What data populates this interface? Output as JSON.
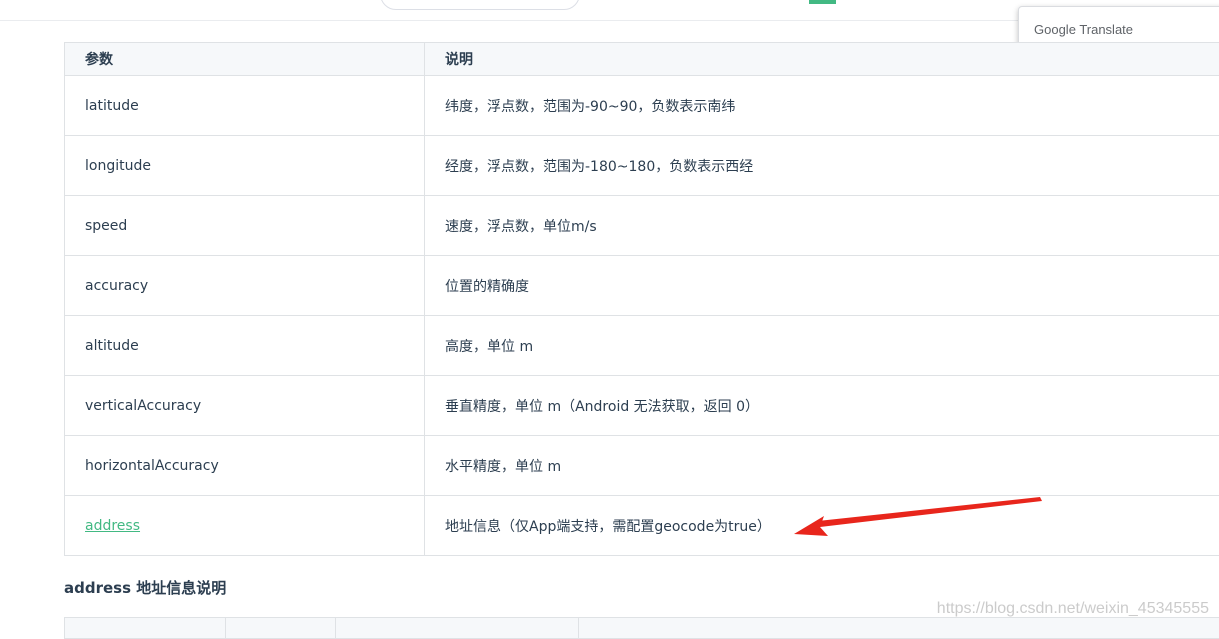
{
  "translate_popup": {
    "brand": "Google",
    "product": "Translate"
  },
  "table": {
    "headers": [
      "参数",
      "说明"
    ],
    "rows": [
      {
        "param": "latitude",
        "desc": "纬度，浮点数，范围为-90~90，负数表示南纬"
      },
      {
        "param": "longitude",
        "desc": "经度，浮点数，范围为-180~180，负数表示西经"
      },
      {
        "param": "speed",
        "desc": "速度，浮点数，单位m/s"
      },
      {
        "param": "accuracy",
        "desc": "位置的精确度"
      },
      {
        "param": "altitude",
        "desc": "高度，单位 m"
      },
      {
        "param": "verticalAccuracy",
        "desc": "垂直精度，单位 m（Android 无法获取，返回 0）"
      },
      {
        "param": "horizontalAccuracy",
        "desc": "水平精度，单位 m"
      },
      {
        "param": "address",
        "desc": "地址信息（仅App端支持，需配置geocode为true）"
      }
    ]
  },
  "section_title": "address 地址信息说明",
  "watermark": "https://blog.csdn.net/weixin_45345555",
  "colors": {
    "link": "#42b983",
    "arrow": "#e8261c",
    "header_bg": "#f6f8fa",
    "border": "#dfe2e5"
  }
}
